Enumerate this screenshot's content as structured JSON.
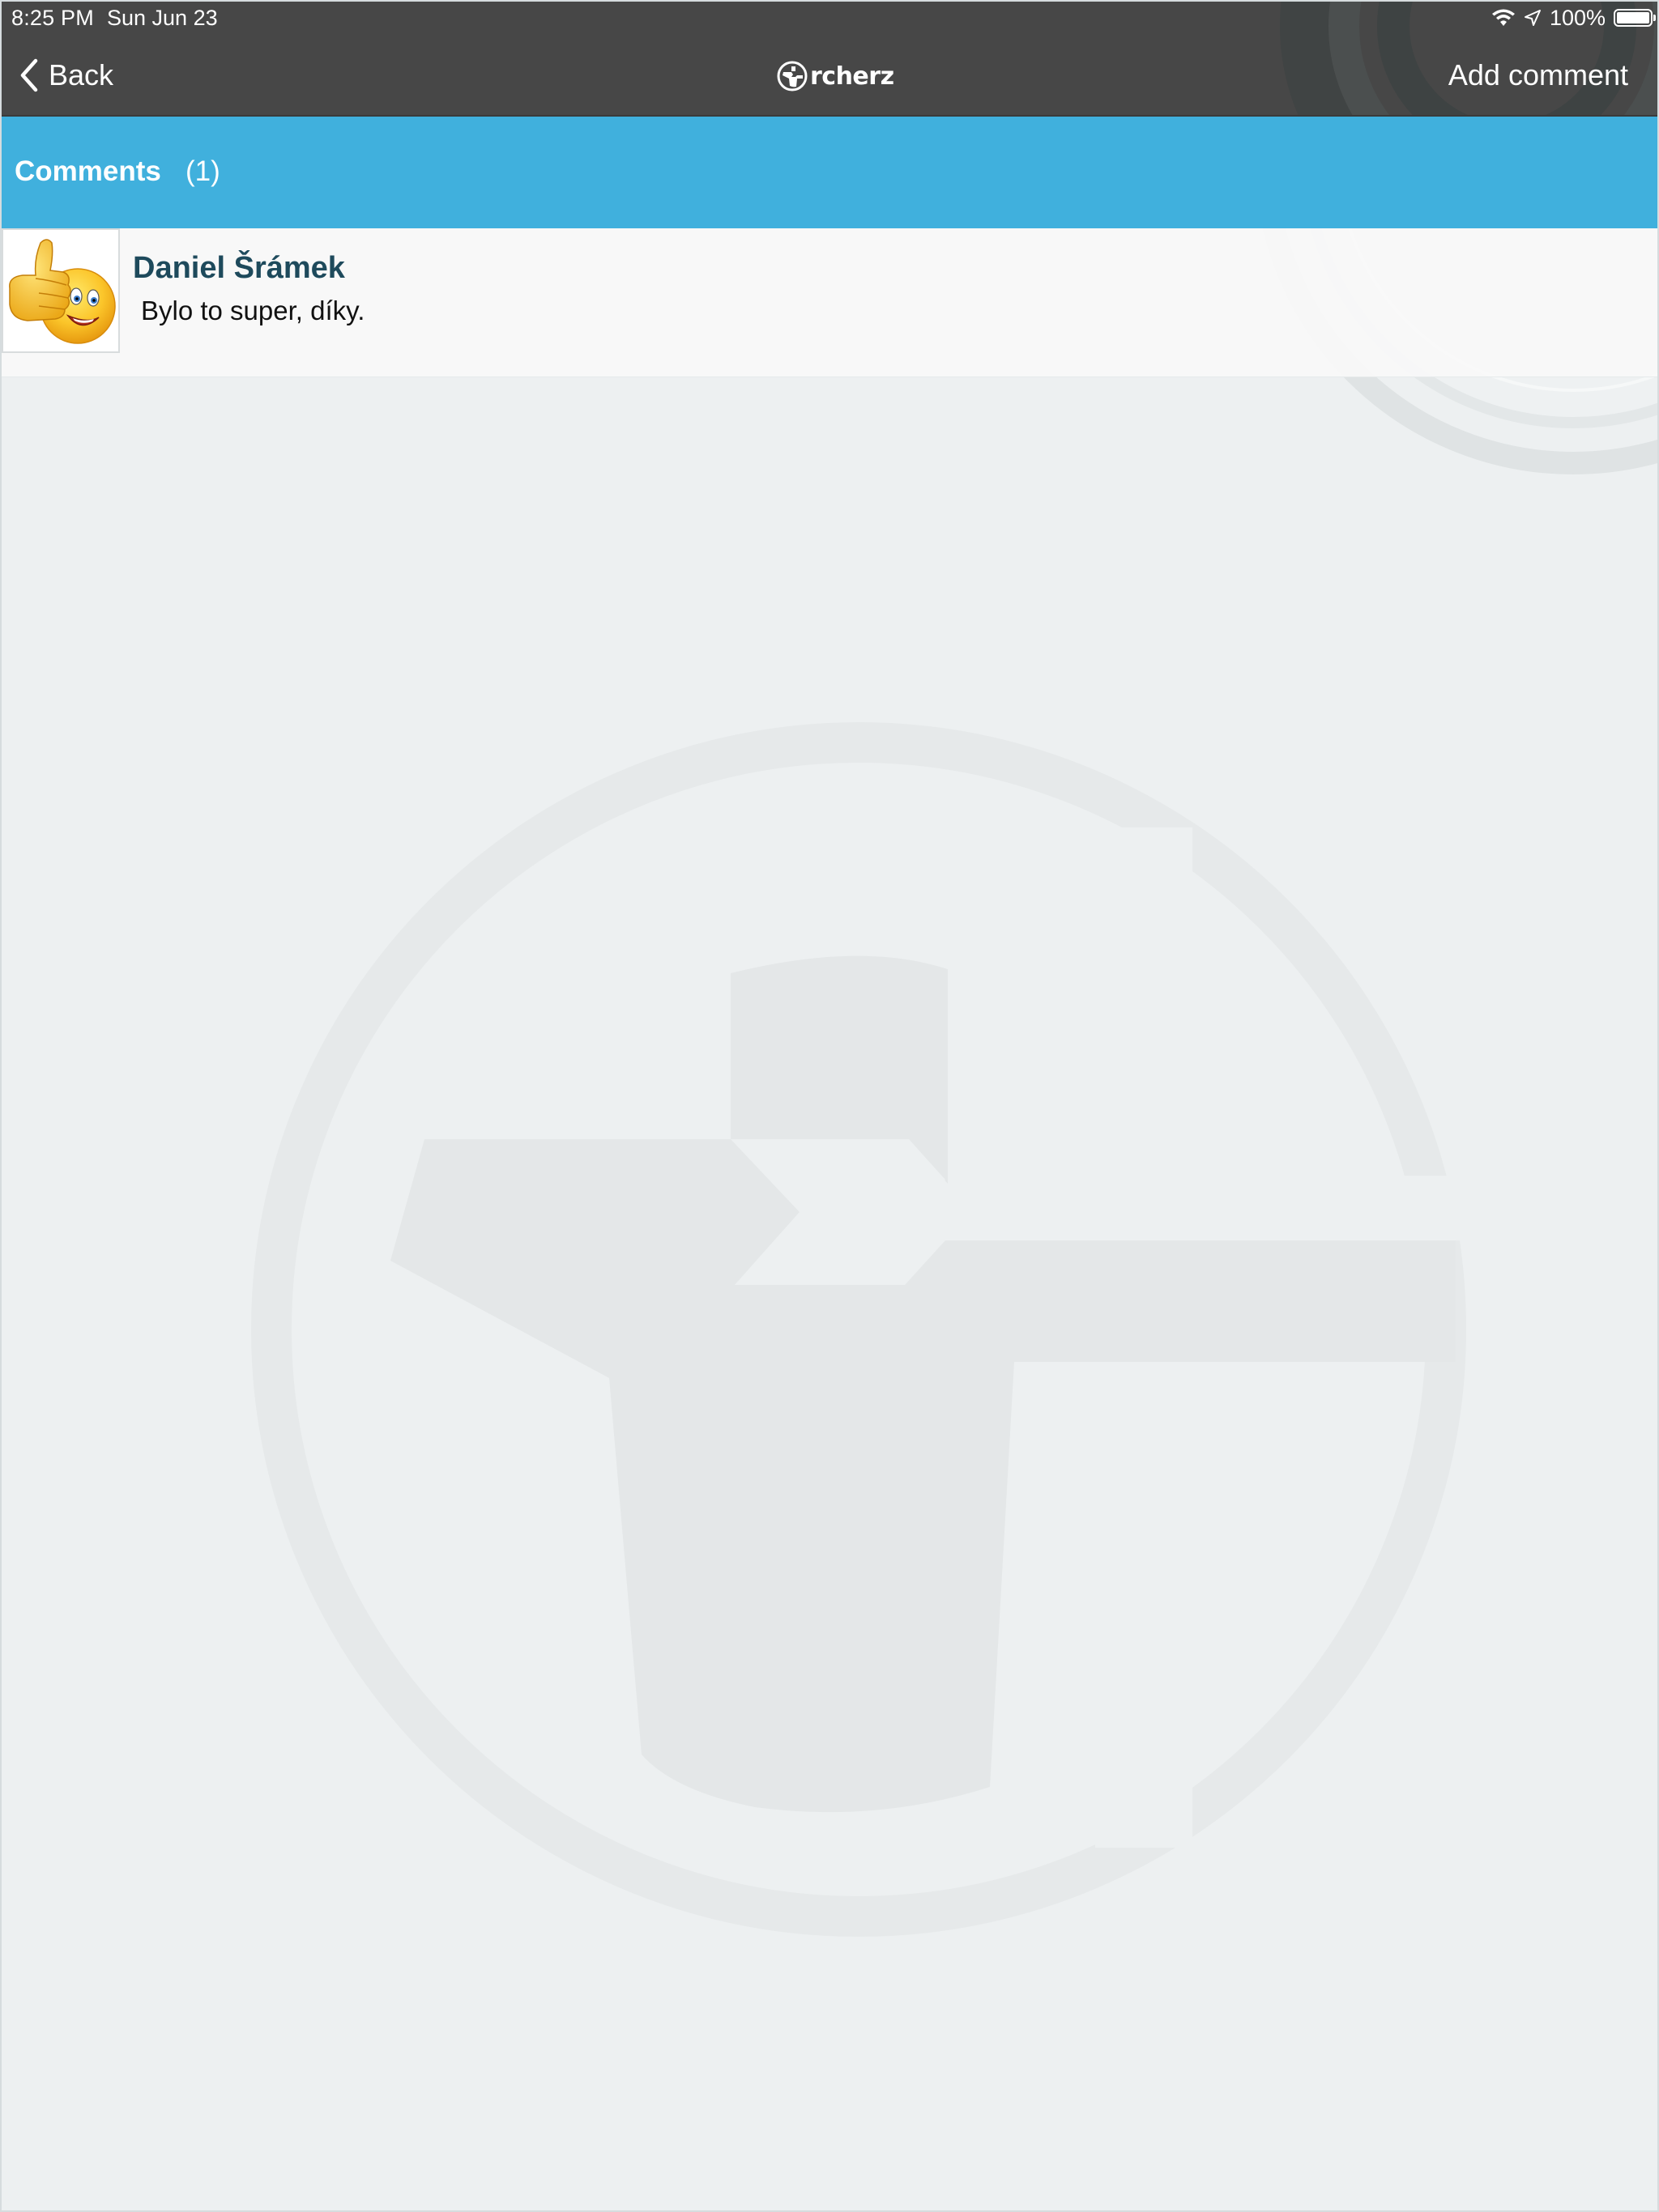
{
  "status_bar": {
    "time": "8:25 PM",
    "date": "Sun Jun 23",
    "battery": "100%",
    "battery_level": 1.0,
    "icons": [
      "wifi-icon",
      "location-arrow-icon",
      "battery-icon"
    ]
  },
  "nav": {
    "back_label": "Back",
    "logo_text": "rcherz",
    "add_comment_label": "Add comment"
  },
  "section": {
    "title": "Comments",
    "count": "(1)"
  },
  "comments": [
    {
      "author": "Daniel Šrámek",
      "text": "Bylo to super, díky.",
      "avatar": "thumbs-up-smiley-icon"
    }
  ],
  "colors": {
    "topbar": "#474747",
    "header": "#40b0dd",
    "background": "#edf0f1",
    "author": "#1e4a5c"
  }
}
